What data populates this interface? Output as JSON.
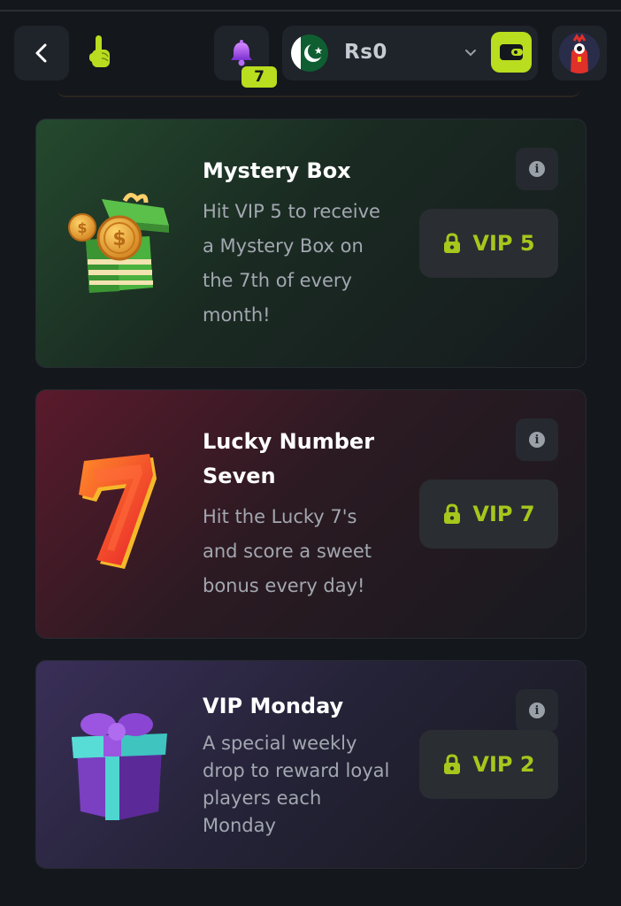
{
  "header": {
    "notification_count": "7",
    "balance": "Rs0"
  },
  "cards": [
    {
      "title": "Mystery Box",
      "description": "Hit VIP 5 to receive a Mystery Box on the 7th of every month!",
      "lock_label": "VIP 5"
    },
    {
      "title": "Lucky Number Seven",
      "description": "Hit the Lucky 7's and score a sweet bonus every day!",
      "lock_label": "VIP 7"
    },
    {
      "title": "VIP Monday",
      "description": "A special weekly drop to reward loyal players each Monday",
      "lock_label": "VIP 2"
    }
  ],
  "colors": {
    "accent": "#b9dd1f",
    "vip_text": "#a6c71c",
    "background": "#14171c"
  }
}
